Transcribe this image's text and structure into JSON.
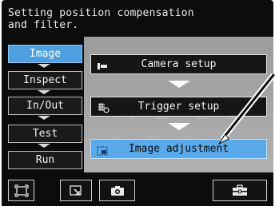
{
  "header": {
    "line1": "Setting position compensation",
    "line2": "and filter."
  },
  "sidebar": {
    "items": [
      {
        "label": "Image",
        "active": true
      },
      {
        "label": "Inspect",
        "active": false
      },
      {
        "label": "In/Out",
        "active": false
      },
      {
        "label": "Test",
        "active": false
      },
      {
        "label": "Run",
        "active": false
      }
    ]
  },
  "menu": {
    "items": [
      {
        "label": "Camera setup",
        "icon": "camera-setup-icon",
        "active": false
      },
      {
        "label": "Trigger setup",
        "icon": "trigger-setup-icon",
        "active": false
      },
      {
        "label": "Image adjustment",
        "icon": "image-adjustment-icon",
        "active": true
      }
    ]
  },
  "toolbar": {
    "buttons": [
      {
        "icon": "fullscreen-icon"
      },
      {
        "icon": "zoom-icon"
      },
      {
        "icon": "camera-icon"
      },
      {
        "icon": "toolbox-icon"
      }
    ]
  },
  "colors": {
    "accent": "#4d9fe0",
    "background": "#0c0c0c",
    "panel": "#a4a4a4"
  }
}
